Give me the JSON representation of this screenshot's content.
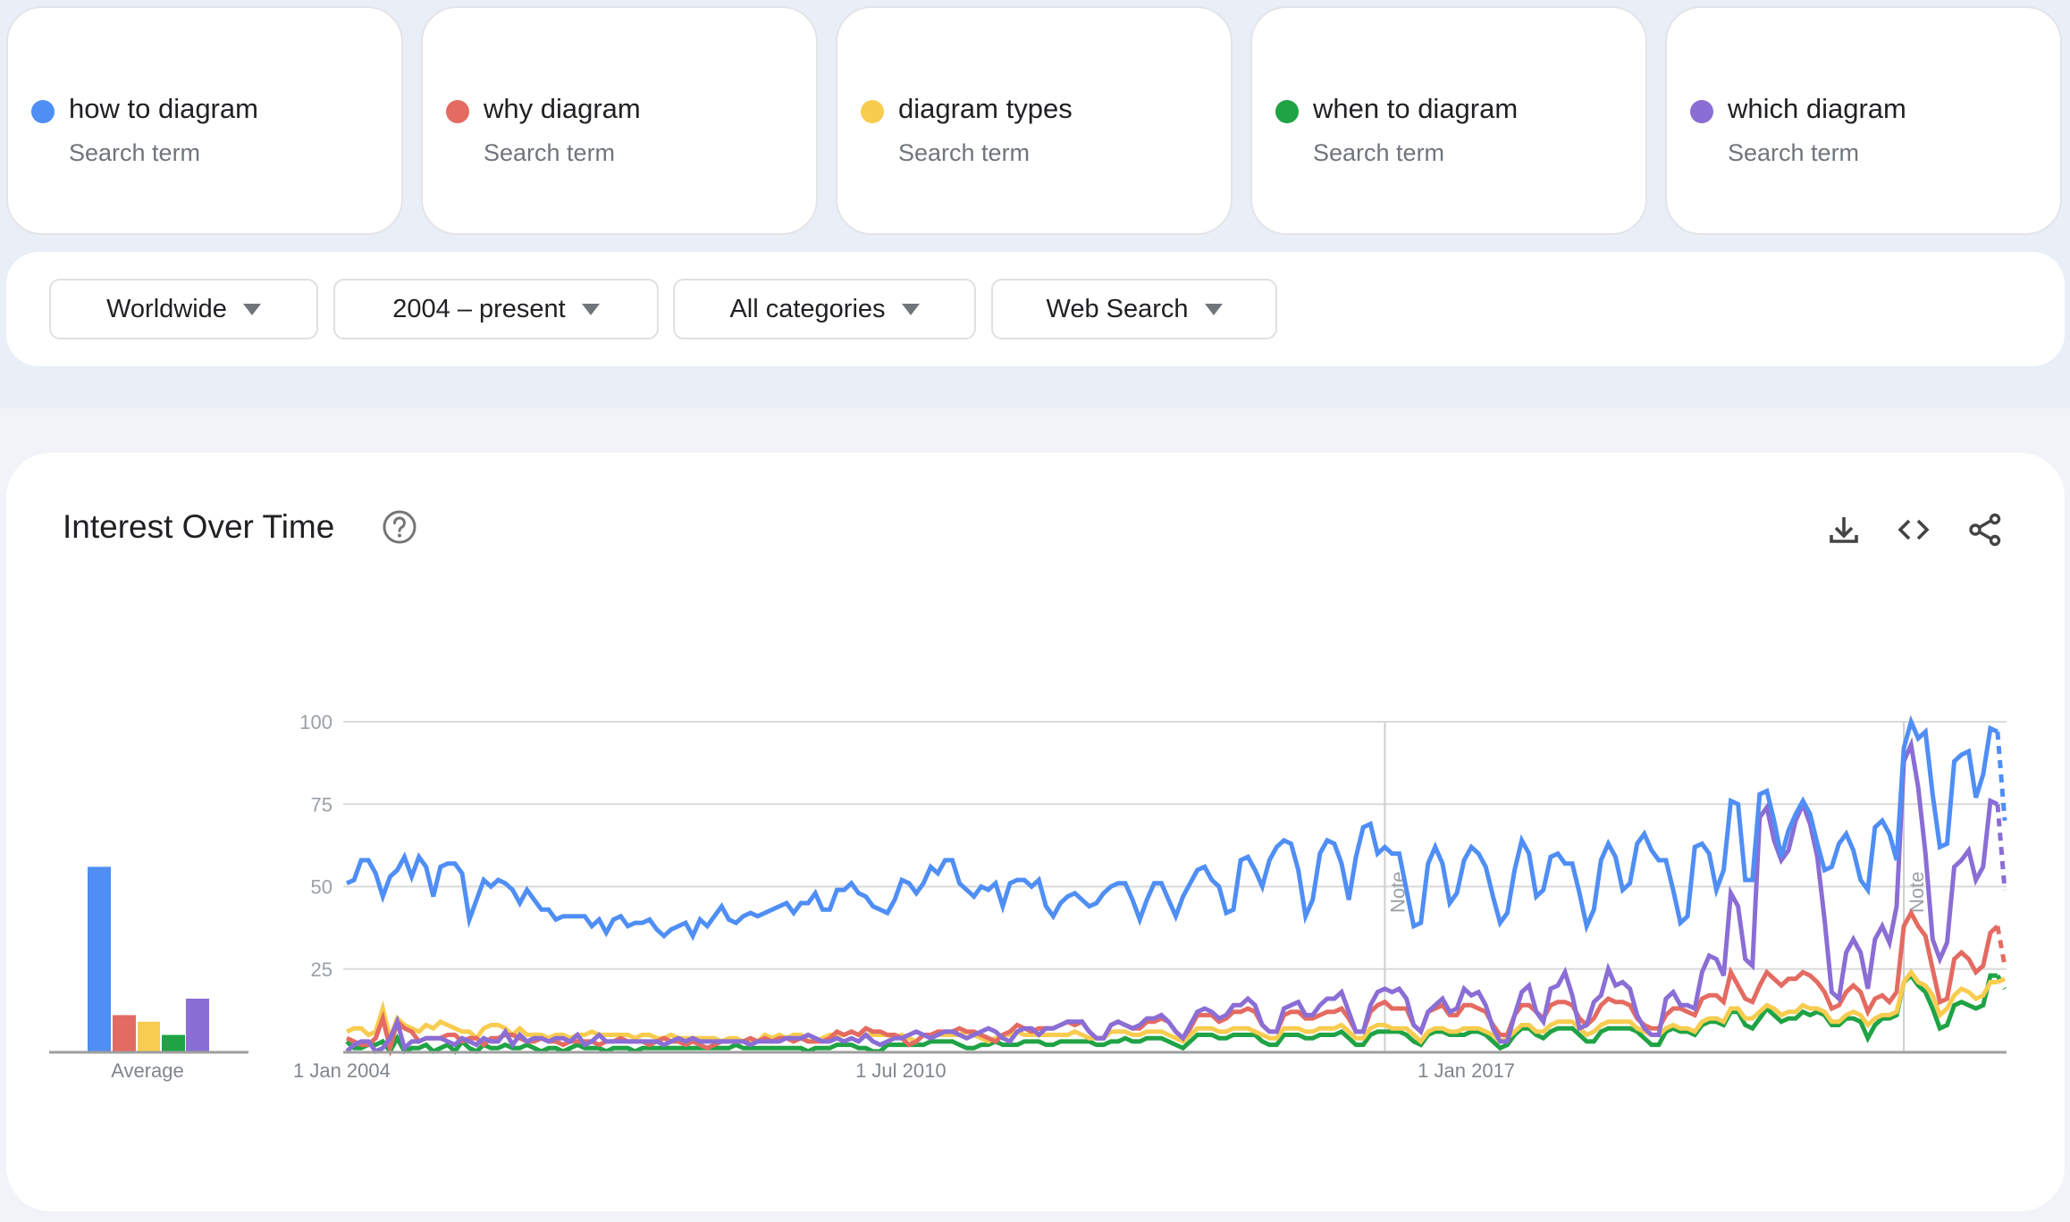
{
  "terms": [
    {
      "name": "how to diagram",
      "sub": "Search term",
      "color": "#4f8ef5"
    },
    {
      "name": "why diagram",
      "sub": "Search term",
      "color": "#e46b62"
    },
    {
      "name": "diagram types",
      "sub": "Search term",
      "color": "#f8cc4f"
    },
    {
      "name": "when to diagram",
      "sub": "Search term",
      "color": "#1fa345"
    },
    {
      "name": "which diagram",
      "sub": "Search term",
      "color": "#8a6ed5"
    }
  ],
  "filters": {
    "region": "Worldwide",
    "time_range": "2004 – present",
    "category": "All categories",
    "search_type": "Web Search"
  },
  "panel": {
    "title": "Interest Over Time",
    "icons": [
      "help-icon",
      "download-icon",
      "embed-code-icon",
      "share-icon"
    ]
  },
  "chart_data": {
    "type": "line",
    "title": "Interest Over Time",
    "xlabel": "",
    "ylabel": "",
    "ylim": [
      0,
      100
    ],
    "yticks": [
      "100",
      "75",
      "50",
      "25"
    ],
    "ytick_values": [
      100,
      75,
      50,
      25
    ],
    "x_start": "2004-01",
    "x_frequency": "monthly",
    "xtick_labels": [
      {
        "label": "1 Jan 2004",
        "index": 0
      },
      {
        "label": "1 Jul 2010",
        "index": 78
      },
      {
        "label": "1 Jan 2017",
        "index": 156
      }
    ],
    "notes": [
      {
        "label": "Note",
        "index": 144
      },
      {
        "label": "Note",
        "index": 216
      }
    ],
    "last_segment_partial": true,
    "grid": true,
    "legend": "top (search term cards)",
    "average": {
      "label": "Average",
      "values": [
        56,
        11,
        9,
        5,
        16
      ]
    },
    "series": [
      {
        "name": "how to diagram",
        "color": "#4f8ef5",
        "values": [
          51,
          52,
          58,
          58,
          54,
          47,
          53,
          55,
          59,
          53,
          59,
          56,
          47,
          56,
          57,
          57,
          54,
          40,
          46,
          52,
          50,
          52,
          51,
          49,
          45,
          49,
          46,
          43,
          43,
          40,
          41,
          41,
          41,
          41,
          38,
          40,
          36,
          40,
          41,
          38,
          39,
          39,
          40,
          37,
          35,
          37,
          38,
          39,
          35,
          40,
          38,
          41,
          44,
          40,
          39,
          41,
          42,
          41,
          42,
          43,
          44,
          45,
          42,
          45,
          45,
          48,
          43,
          43,
          49,
          49,
          51,
          48,
          47,
          44,
          43,
          42,
          46,
          52,
          51,
          48,
          51,
          56,
          54,
          58,
          58,
          51,
          49,
          47,
          50,
          49,
          51,
          44,
          51,
          52,
          52,
          50,
          52,
          44,
          41,
          45,
          47,
          48,
          46,
          44,
          45,
          48,
          50,
          51,
          51,
          46,
          40,
          46,
          51,
          51,
          46,
          41,
          47,
          51,
          55,
          56,
          52,
          50,
          42,
          43,
          58,
          59,
          55,
          50,
          58,
          62,
          64,
          63,
          55,
          41,
          46,
          60,
          64,
          63,
          57,
          46,
          59,
          68,
          69,
          60,
          62,
          60,
          60,
          49,
          38,
          39,
          57,
          62,
          57,
          45,
          48,
          58,
          62,
          60,
          56,
          47,
          39,
          42,
          55,
          64,
          60,
          47,
          49,
          59,
          60,
          57,
          57,
          48,
          38,
          43,
          58,
          63,
          59,
          49,
          51,
          63,
          66,
          61,
          58,
          58,
          49,
          39,
          41,
          62,
          63,
          60,
          49,
          55,
          76,
          75,
          52,
          52,
          78,
          79,
          70,
          59,
          67,
          72,
          76,
          72,
          63,
          55,
          56,
          63,
          66,
          61,
          52,
          49,
          68,
          70,
          66,
          58,
          92,
          100,
          95,
          97,
          78,
          62,
          63,
          88,
          90,
          91,
          77,
          84,
          98,
          97,
          70
        ]
      },
      {
        "name": "why diagram",
        "color": "#e46b62",
        "values": [
          4,
          3,
          2,
          2,
          4,
          10,
          1,
          9,
          7,
          6,
          3,
          4,
          4,
          4,
          5,
          5,
          3,
          4,
          4,
          2,
          4,
          4,
          5,
          5,
          4,
          3,
          3,
          4,
          3,
          3,
          2,
          3,
          3,
          3,
          3,
          2,
          3,
          3,
          4,
          3,
          3,
          3,
          2,
          3,
          4,
          3,
          3,
          2,
          3,
          2,
          1,
          2,
          3,
          3,
          3,
          3,
          4,
          3,
          4,
          3,
          4,
          4,
          3,
          4,
          3,
          3,
          3,
          4,
          6,
          5,
          6,
          5,
          7,
          6,
          6,
          5,
          5,
          4,
          2,
          3,
          5,
          5,
          6,
          6,
          6,
          7,
          6,
          6,
          5,
          4,
          3,
          5,
          6,
          8,
          7,
          6,
          7,
          7,
          7,
          8,
          9,
          8,
          9,
          6,
          4,
          4,
          8,
          9,
          8,
          7,
          7,
          9,
          9,
          10,
          9,
          6,
          4,
          7,
          11,
          11,
          11,
          9,
          10,
          12,
          12,
          13,
          12,
          8,
          6,
          6,
          11,
          12,
          12,
          10,
          10,
          11,
          12,
          12,
          13,
          10,
          6,
          6,
          12,
          14,
          15,
          13,
          13,
          13,
          8,
          6,
          12,
          13,
          14,
          11,
          11,
          14,
          14,
          13,
          12,
          8,
          5,
          5,
          11,
          14,
          14,
          12,
          10,
          14,
          15,
          15,
          14,
          10,
          8,
          10,
          14,
          16,
          15,
          15,
          14,
          10,
          8,
          7,
          7,
          11,
          13,
          13,
          12,
          11,
          16,
          17,
          17,
          15,
          24,
          20,
          16,
          15,
          20,
          24,
          22,
          20,
          22,
          22,
          24,
          23,
          21,
          18,
          13,
          14,
          18,
          20,
          18,
          12,
          16,
          17,
          15,
          18,
          38,
          42,
          38,
          35,
          25,
          15,
          16,
          28,
          30,
          28,
          24,
          26,
          36,
          38,
          26
        ]
      },
      {
        "name": "diagram types",
        "color": "#f8cc4f",
        "values": [
          6,
          7,
          7,
          5,
          6,
          13,
          4,
          10,
          8,
          7,
          6,
          8,
          7,
          9,
          8,
          7,
          6,
          6,
          4,
          7,
          8,
          8,
          7,
          5,
          7,
          5,
          5,
          5,
          4,
          5,
          5,
          4,
          5,
          5,
          6,
          5,
          5,
          5,
          5,
          5,
          4,
          5,
          5,
          4,
          4,
          5,
          4,
          4,
          4,
          4,
          4,
          4,
          3,
          4,
          4,
          3,
          3,
          3,
          5,
          4,
          5,
          4,
          5,
          5,
          3,
          3,
          4,
          5,
          5,
          5,
          6,
          5,
          5,
          5,
          5,
          5,
          4,
          5,
          4,
          3,
          5,
          5,
          5,
          5,
          5,
          5,
          6,
          5,
          4,
          3,
          4,
          5,
          5,
          6,
          5,
          5,
          5,
          5,
          5,
          5,
          5,
          6,
          5,
          4,
          4,
          4,
          6,
          6,
          6,
          5,
          5,
          6,
          6,
          6,
          5,
          4,
          3,
          5,
          7,
          7,
          7,
          6,
          6,
          7,
          7,
          7,
          6,
          5,
          4,
          4,
          7,
          7,
          7,
          6,
          6,
          7,
          7,
          7,
          8,
          6,
          4,
          4,
          7,
          8,
          8,
          7,
          7,
          7,
          5,
          3,
          6,
          7,
          7,
          6,
          6,
          7,
          7,
          7,
          6,
          5,
          3,
          4,
          6,
          8,
          8,
          6,
          6,
          8,
          9,
          9,
          9,
          7,
          5,
          6,
          8,
          9,
          9,
          9,
          9,
          7,
          6,
          5,
          5,
          7,
          8,
          7,
          7,
          6,
          9,
          10,
          10,
          9,
          13,
          13,
          10,
          10,
          12,
          14,
          13,
          11,
          12,
          12,
          14,
          13,
          13,
          12,
          9,
          9,
          11,
          12,
          11,
          8,
          10,
          11,
          11,
          12,
          21,
          24,
          21,
          20,
          17,
          11,
          13,
          17,
          19,
          18,
          16,
          17,
          21,
          21,
          22
        ]
      },
      {
        "name": "when to diagram",
        "color": "#1fa345",
        "values": [
          3,
          1,
          1,
          2,
          2,
          3,
          0,
          4,
          0,
          1,
          1,
          2,
          0,
          1,
          2,
          0,
          3,
          1,
          0,
          2,
          1,
          1,
          2,
          1,
          1,
          2,
          1,
          0,
          1,
          1,
          0,
          1,
          2,
          1,
          1,
          1,
          0,
          1,
          1,
          1,
          0,
          1,
          1,
          1,
          1,
          1,
          1,
          1,
          1,
          1,
          1,
          1,
          1,
          1,
          2,
          1,
          1,
          1,
          1,
          1,
          1,
          1,
          1,
          1,
          0,
          1,
          1,
          1,
          2,
          2,
          2,
          1,
          1,
          0,
          0,
          2,
          2,
          2,
          2,
          2,
          2,
          3,
          3,
          3,
          3,
          2,
          1,
          1,
          2,
          2,
          3,
          2,
          2,
          2,
          3,
          3,
          3,
          2,
          2,
          3,
          3,
          3,
          3,
          3,
          2,
          2,
          3,
          3,
          4,
          3,
          3,
          4,
          4,
          4,
          3,
          2,
          1,
          3,
          5,
          5,
          5,
          4,
          4,
          5,
          5,
          5,
          5,
          3,
          2,
          2,
          5,
          5,
          5,
          4,
          4,
          5,
          5,
          5,
          6,
          4,
          2,
          2,
          5,
          6,
          6,
          6,
          6,
          5,
          3,
          2,
          5,
          6,
          6,
          5,
          5,
          5,
          6,
          6,
          5,
          3,
          1,
          2,
          5,
          7,
          7,
          5,
          4,
          6,
          7,
          7,
          7,
          5,
          3,
          3,
          6,
          7,
          7,
          7,
          7,
          6,
          4,
          2,
          2,
          6,
          7,
          6,
          6,
          5,
          8,
          9,
          9,
          8,
          12,
          12,
          8,
          7,
          10,
          13,
          11,
          9,
          10,
          10,
          12,
          11,
          12,
          11,
          8,
          8,
          10,
          10,
          9,
          4,
          8,
          10,
          10,
          11,
          21,
          23,
          20,
          18,
          13,
          7,
          8,
          14,
          15,
          14,
          13,
          14,
          23,
          23,
          19
        ]
      },
      {
        "name": "which diagram",
        "color": "#8a6ed5",
        "values": [
          0,
          2,
          3,
          3,
          0,
          1,
          4,
          9,
          1,
          3,
          3,
          4,
          4,
          4,
          3,
          2,
          4,
          3,
          2,
          4,
          3,
          3,
          6,
          2,
          5,
          3,
          4,
          4,
          3,
          4,
          4,
          3,
          5,
          2,
          3,
          5,
          3,
          3,
          3,
          3,
          3,
          3,
          3,
          3,
          2,
          3,
          4,
          3,
          4,
          3,
          3,
          3,
          3,
          3,
          3,
          3,
          2,
          3,
          3,
          3,
          3,
          4,
          4,
          4,
          5,
          4,
          3,
          3,
          4,
          3,
          4,
          3,
          5,
          3,
          2,
          3,
          4,
          4,
          5,
          6,
          5,
          4,
          5,
          6,
          6,
          5,
          4,
          5,
          6,
          7,
          6,
          4,
          3,
          6,
          7,
          7,
          5,
          7,
          7,
          8,
          9,
          9,
          9,
          6,
          4,
          4,
          8,
          9,
          8,
          7,
          8,
          10,
          10,
          11,
          9,
          6,
          4,
          8,
          12,
          13,
          12,
          10,
          11,
          14,
          14,
          16,
          14,
          8,
          6,
          6,
          13,
          14,
          15,
          11,
          11,
          14,
          16,
          16,
          18,
          12,
          6,
          6,
          14,
          18,
          19,
          18,
          19,
          16,
          8,
          6,
          12,
          14,
          16,
          12,
          13,
          19,
          17,
          18,
          14,
          7,
          3,
          3,
          11,
          18,
          20,
          12,
          9,
          19,
          20,
          24,
          17,
          7,
          8,
          15,
          17,
          25,
          20,
          21,
          19,
          11,
          7,
          5,
          5,
          16,
          18,
          14,
          14,
          13,
          24,
          29,
          28,
          23,
          48,
          44,
          28,
          26,
          71,
          74,
          64,
          58,
          61,
          70,
          75,
          69,
          59,
          40,
          18,
          16,
          30,
          34,
          30,
          19,
          34,
          38,
          33,
          44,
          88,
          93,
          80,
          60,
          34,
          28,
          33,
          56,
          58,
          61,
          52,
          56,
          76,
          75,
          49
        ]
      }
    ]
  }
}
